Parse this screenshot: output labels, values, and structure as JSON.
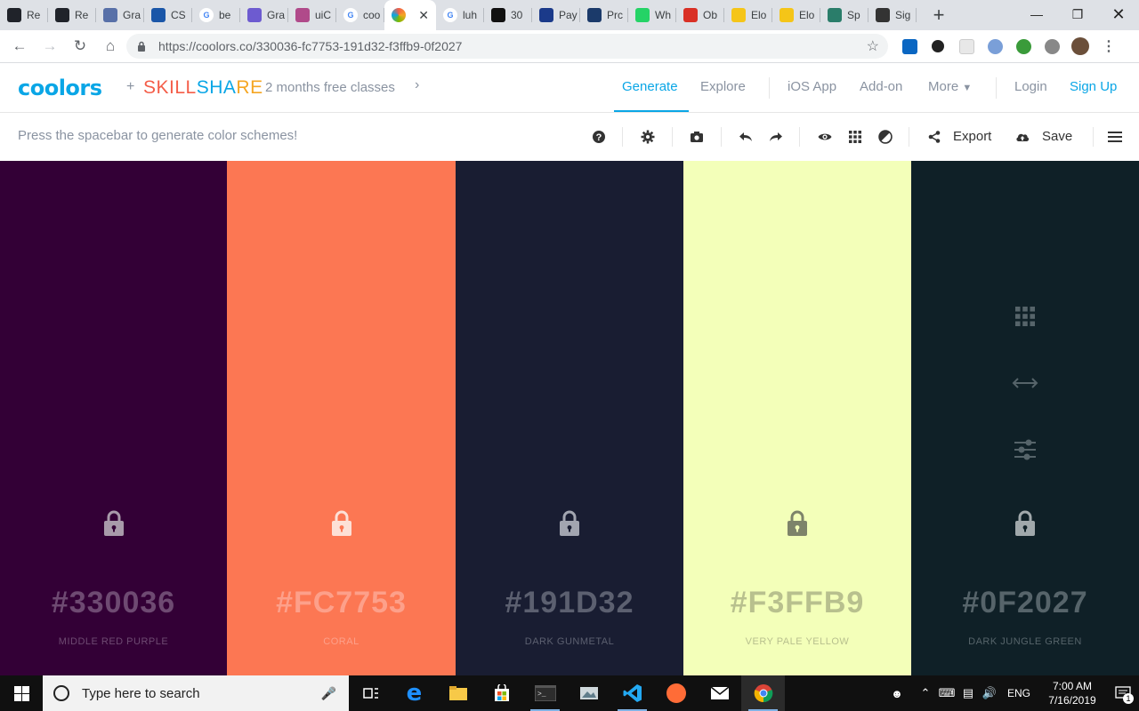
{
  "browser": {
    "tabs": [
      {
        "label": "Re",
        "icon": "react-icon",
        "color": "#20232a"
      },
      {
        "label": "Re",
        "icon": "react-icon",
        "color": "#20232a"
      },
      {
        "label": "Gra",
        "icon": "grafana-icon",
        "color": "#5870a8"
      },
      {
        "label": "CS",
        "icon": "globe-icon",
        "color": "#1a56a8"
      },
      {
        "label": "be",
        "icon": "google-icon",
        "color": "#4285f4"
      },
      {
        "label": "Gra",
        "icon": "firefox-icon",
        "color": "#6d5bd0"
      },
      {
        "label": "uiC",
        "icon": "uigradient-icon",
        "color": "#b04a8a"
      },
      {
        "label": "coo",
        "icon": "google-icon",
        "color": "#4285f4"
      },
      {
        "label": "",
        "icon": "coolors-icon",
        "color": "#0aa6e6",
        "active": true
      },
      {
        "label": "luh",
        "icon": "google-icon",
        "color": "#4285f4"
      },
      {
        "label": "30",
        "icon": "github-icon",
        "color": "#111"
      },
      {
        "label": "Pay",
        "icon": "w3schools-icon",
        "color": "#1b3a8a"
      },
      {
        "label": "Prc",
        "icon": "pt-icon",
        "color": "#1b3a6a"
      },
      {
        "label": "Wh",
        "icon": "whatsapp-icon",
        "color": "#25d366"
      },
      {
        "label": "Ob",
        "icon": "ob-icon",
        "color": "#d93025"
      },
      {
        "label": "Elo",
        "icon": "ejs-icon",
        "color": "#f5c518"
      },
      {
        "label": "Elo",
        "icon": "ejs-icon",
        "color": "#f5c518"
      },
      {
        "label": "Sp",
        "icon": "sp-icon",
        "color": "#2a7d6a"
      },
      {
        "label": "Sig",
        "icon": "braces-icon",
        "color": "#333"
      }
    ],
    "url": "https://coolors.co/330036-fc7753-191d32-f3ffb9-0f2027"
  },
  "header": {
    "logo": "coolors",
    "plus": "+",
    "skillshare": {
      "p1": "SKILL",
      "p2": "SHA",
      "p3": "RE"
    },
    "promo": "2 months free classes",
    "nav": {
      "generate": "Generate",
      "explore": "Explore",
      "ios": "iOS App",
      "addon": "Add-on",
      "more": "More",
      "login": "Login",
      "signup": "Sign Up"
    }
  },
  "toolbar": {
    "hint": "Press the spacebar to generate color schemes!",
    "export": "Export",
    "save": "Save"
  },
  "palette": [
    {
      "hex": "#330036",
      "name": "MIDDLE RED PURPLE",
      "bg": "#330036",
      "fg": "#6e4a72",
      "lockfg": "#a89aaa"
    },
    {
      "hex": "#FC7753",
      "name": "CORAL",
      "bg": "#fc7753",
      "fg": "#fda08a",
      "lockfg": "#fde0d6"
    },
    {
      "hex": "#191D32",
      "name": "DARK GUNMETAL",
      "bg": "#191d32",
      "fg": "#5c6070",
      "lockfg": "#a2a5b0"
    },
    {
      "hex": "#F3FFB9",
      "name": "VERY PALE YELLOW",
      "bg": "#f3ffb9",
      "fg": "#b8c08e",
      "lockfg": "#7d836a"
    },
    {
      "hex": "#0F2027",
      "name": "DARK JUNGLE GREEN",
      "bg": "#0f2027",
      "fg": "#56646a",
      "lockfg": "#a0a8ab"
    }
  ],
  "taskbar": {
    "search_placeholder": "Type here to search",
    "lang": "ENG",
    "time": "7:00 AM",
    "date": "7/16/2019",
    "notif_count": "1"
  }
}
